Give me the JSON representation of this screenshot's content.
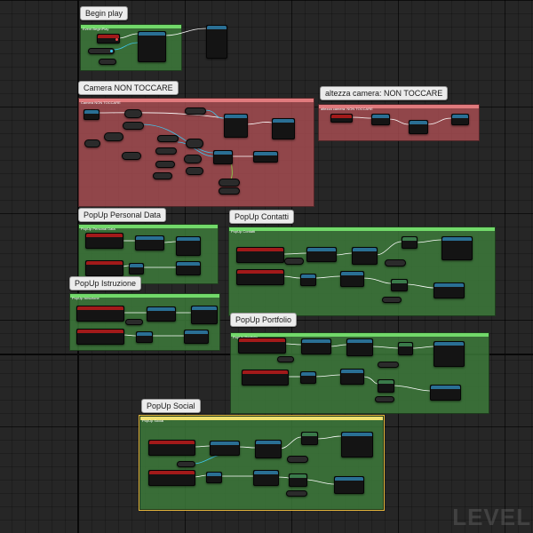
{
  "comments": {
    "begin_play": {
      "bubble": "Begin play",
      "title": "Event BeginPlay"
    },
    "camera": {
      "bubble": "Camera NON TOCCARE",
      "title": "Camera NON TOCCARE"
    },
    "altezza_camera": {
      "bubble": "altezza camera: NON TOCCARE",
      "title": "altezza camera: NON TOCCARE"
    },
    "personal_data": {
      "bubble": "PopUp Personal Data",
      "title": "PopUp Personal Data"
    },
    "contatti": {
      "bubble": "PopUp Contatti",
      "title": "PopUp Contatti"
    },
    "istruzione": {
      "bubble": "PopUp Istruzione",
      "title": "PopUp Istruzione"
    },
    "portfolio": {
      "bubble": "PopUp Portfolio",
      "title": "PopUp Portfolio"
    },
    "social": {
      "bubble": "PopUp Social",
      "title": "PopUp Social"
    }
  },
  "watermark": "LEVEL",
  "colors": {
    "comment_green": "#3e803c",
    "comment_red": "#b05054",
    "event_header": "#a21a1a",
    "function_header": "#2a6f94",
    "exec_wire": "#ffffff",
    "data_wire": "#3ec8f0",
    "selection": "#e4b43a"
  }
}
